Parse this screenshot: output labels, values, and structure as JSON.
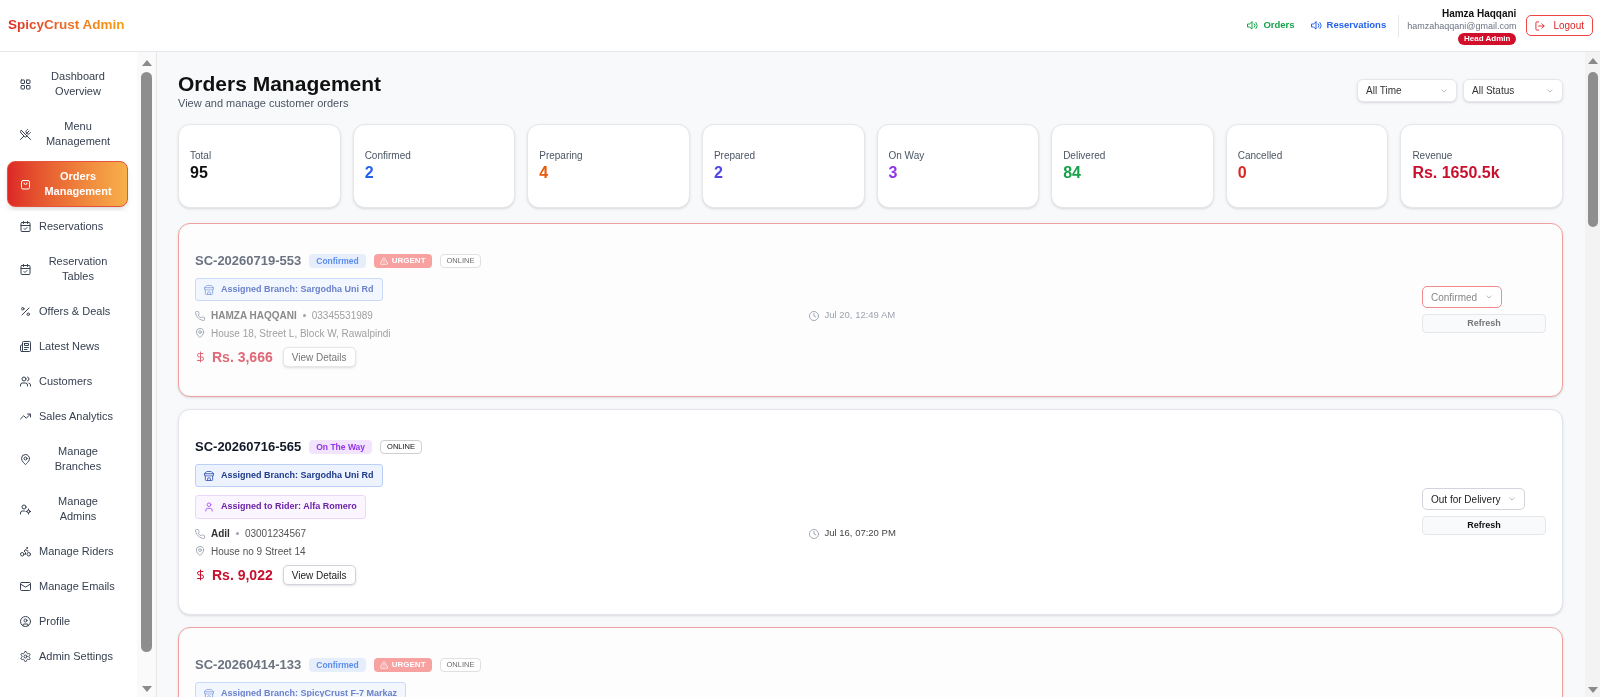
{
  "header": {
    "logo": "SpicyCrust Admin",
    "links": [
      {
        "label": "Orders",
        "color": "#16a34a"
      },
      {
        "label": "Reservations",
        "color": "#2563eb"
      }
    ],
    "user": {
      "name": "Hamza Haqqani",
      "email": "hamzahaqqani@gmail.com",
      "role": "Head Admin"
    },
    "logout": "Logout"
  },
  "sidebar": {
    "items": [
      {
        "label": "Dashboard Overview",
        "selected": false
      },
      {
        "label": "Menu Management",
        "selected": false
      },
      {
        "label": "Orders Management",
        "selected": true
      },
      {
        "label": "Reservations",
        "selected": false
      },
      {
        "label": "Reservation Tables",
        "selected": false
      },
      {
        "label": "Offers & Deals",
        "selected": false
      },
      {
        "label": "Latest News",
        "selected": false
      },
      {
        "label": "Customers",
        "selected": false
      },
      {
        "label": "Sales Analytics",
        "selected": false
      },
      {
        "label": "Manage Branches",
        "selected": false
      },
      {
        "label": "Manage Admins",
        "selected": false
      },
      {
        "label": "Manage Riders",
        "selected": false
      },
      {
        "label": "Manage Emails",
        "selected": false
      },
      {
        "label": "Profile",
        "selected": false
      },
      {
        "label": "Admin Settings",
        "selected": false
      }
    ]
  },
  "page": {
    "title": "Orders Management",
    "subtitle": "View and manage customer orders",
    "filters": [
      "All Time",
      "All Status"
    ]
  },
  "stats": [
    {
      "label": "Total",
      "value": "95",
      "color": "#111111"
    },
    {
      "label": "Confirmed",
      "value": "2",
      "color": "#2563eb"
    },
    {
      "label": "Preparing",
      "value": "4",
      "color": "#ea580c"
    },
    {
      "label": "Prepared",
      "value": "2",
      "color": "#4f46e5"
    },
    {
      "label": "On Way",
      "value": "3",
      "color": "#9333ea"
    },
    {
      "label": "Delivered",
      "value": "84",
      "color": "#16a34a"
    },
    {
      "label": "Cancelled",
      "value": "0",
      "color": "#dc2626"
    },
    {
      "label": "Revenue",
      "value": "Rs. 1650.5k",
      "color": "#c8102e"
    }
  ],
  "orders": [
    {
      "id": "SC-20260719-553",
      "urgent": true,
      "badges": [
        {
          "kind": "status",
          "text": "Confirmed",
          "color": "#5b8def"
        },
        {
          "kind": "urgent",
          "text": "URGENT"
        },
        {
          "kind": "channel",
          "text": "ONLINE"
        }
      ],
      "branch": "Assigned Branch: Sargodha Uni Rd",
      "customer": "HAMZA HAQQANI",
      "phone": "03345531989",
      "address": "House 18, Street L, Block W, Rawalpindi",
      "date": "Jul 20, 12:49 AM",
      "total": "Rs. 3,666",
      "details_button": "View Details",
      "status_select": "Confirmed",
      "refresh_button": "Refresh"
    },
    {
      "id": "SC-20260716-565",
      "urgent": false,
      "badges": [
        {
          "kind": "status",
          "text": "On The Way",
          "color": "#9333ea"
        },
        {
          "kind": "channel",
          "text": "ONLINE"
        }
      ],
      "branch": "Assigned Branch: Sargodha Uni Rd",
      "rider": "Assigned to Rider: Alfa Romero",
      "customer": "Adil",
      "phone": "03001234567",
      "address": "House no 9 Street 14",
      "date": "Jul 16, 07:20 PM",
      "total": "Rs. 9,022",
      "details_button": "View Details",
      "status_select": "Out for Delivery",
      "refresh_button": "Refresh"
    },
    {
      "id": "SC-20260414-133",
      "urgent": true,
      "badges": [
        {
          "kind": "status",
          "text": "Confirmed",
          "color": "#5b8def"
        },
        {
          "kind": "urgent",
          "text": "URGENT"
        },
        {
          "kind": "channel",
          "text": "ONLINE"
        }
      ],
      "branch": "Assigned Branch: SpicyCrust F-7 Markaz"
    }
  ]
}
